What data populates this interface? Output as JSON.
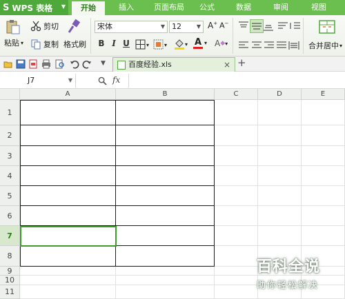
{
  "app": {
    "name": "WPS 表格",
    "logo": "S"
  },
  "menu_tabs": [
    "开始",
    "插入",
    "页面布局",
    "公式",
    "数据",
    "审阅",
    "视图"
  ],
  "ribbon": {
    "paste_label": "粘贴",
    "cut_label": "剪切",
    "copy_label": "复制",
    "format_painter_label": "格式刷",
    "font_name": "宋体",
    "font_size": "12",
    "merge_label": "合并居中",
    "bold": "B",
    "italic": "I",
    "underline": "U",
    "font_color_letter": "A",
    "grow_font": "A+",
    "shrink_font": "A-",
    "clear_letter": "A"
  },
  "document": {
    "tab_title": "百度经验.xls",
    "close_glyph": "×",
    "new_tab_glyph": "+"
  },
  "formula_bar": {
    "cell_ref": "J7",
    "fx_label": "fx",
    "value": ""
  },
  "sheet": {
    "columns": [
      "A",
      "B",
      "C",
      "D",
      "E"
    ],
    "rows": [
      "1",
      "2",
      "3",
      "4",
      "5",
      "6",
      "7",
      "8",
      "9",
      "10",
      "11"
    ],
    "selected_row": "7",
    "table_columns": [
      "A",
      "B"
    ],
    "table_rows": [
      "1",
      "2",
      "3",
      "4",
      "5",
      "6",
      "7",
      "8"
    ],
    "active_cell": "A7"
  },
  "watermark": {
    "title": "百科全说",
    "subtitle": "助你轻松解决"
  },
  "colors": {
    "accent": "#6bbf4e",
    "accent_dark": "#4fa83a",
    "table_border": "#1a1a1a",
    "active_border": "#3d9b2a"
  }
}
